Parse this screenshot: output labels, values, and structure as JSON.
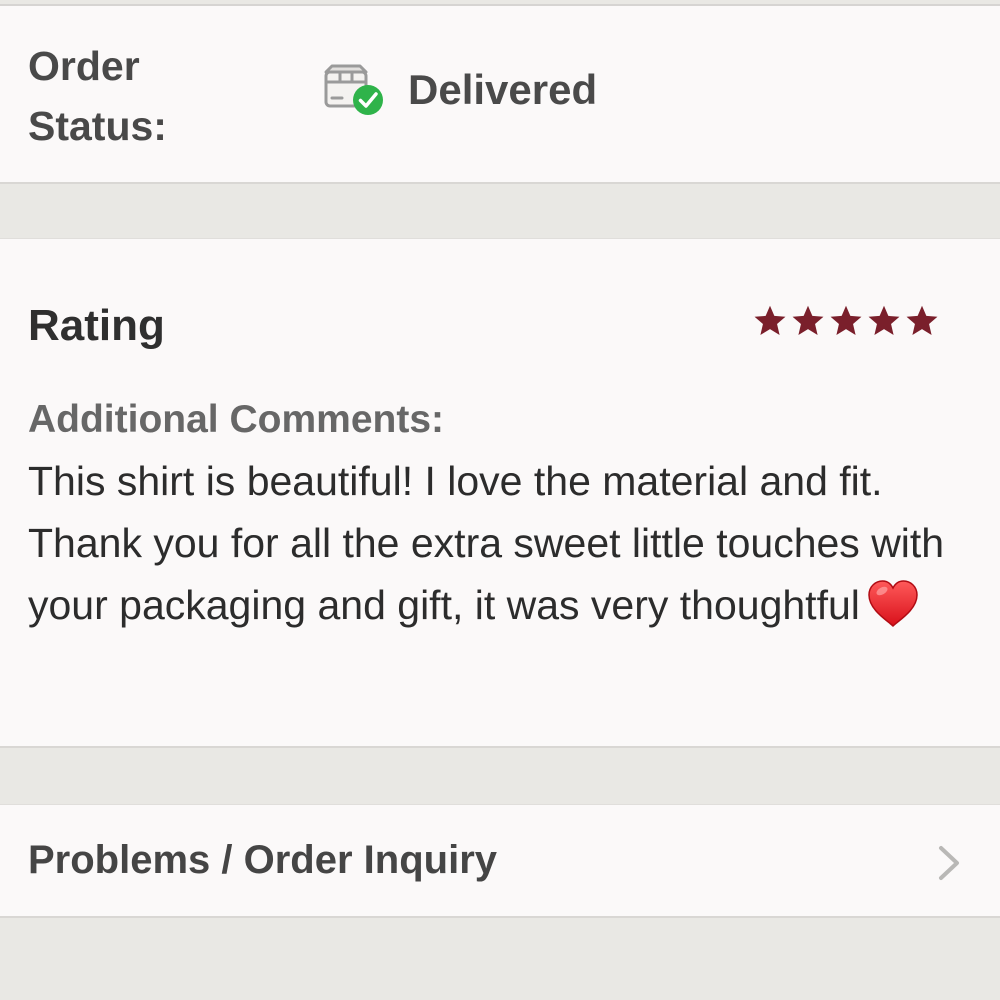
{
  "order_status": {
    "label": "Order Status:",
    "value": "Delivered",
    "icon": "package-delivered-icon",
    "accent_color": "#2fb34a"
  },
  "review": {
    "rating_label": "Rating",
    "rating_value": 5,
    "rating_max": 5,
    "star_color": "#7a1f2b",
    "comments_label": "Additional Comments:",
    "comments_text": "This shirt is beautiful! I love the material and fit. Thank you for all the extra sweet little touches with your packaging and gift, it was very thoughtful",
    "comments_emoji": "red-heart-icon"
  },
  "problems": {
    "label": "Problems / Order Inquiry",
    "icon": "chevron-right-icon"
  }
}
